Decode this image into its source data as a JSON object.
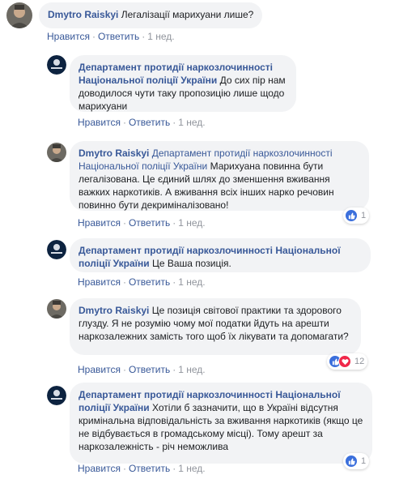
{
  "actions": {
    "like": "Нравится",
    "reply": "Ответить",
    "sep": "·"
  },
  "comments": [
    {
      "author": "Dmytro Raiskyi",
      "text": "Легалізації марихуани лише?",
      "time": "1 нед."
    },
    {
      "author": "Департамент протидії наркозлочинності Національної поліції України",
      "text": "До сих пір нам доводилося чути таку пропозицію лише щодо марихуани",
      "time": "1 нед."
    },
    {
      "author": "Dmytro Raiskyi",
      "mention": "Департамент протидії наркозлочинності Національної поліції України",
      "text": "Марихуана повинна бути легалізована. Це єдиний шлях до зменшення вживання важких наркотиків. А вживання всіх інших нарко речовин повинно бути декриміналізовано!",
      "time": "1 нед.",
      "reactions": {
        "count": "1",
        "types": [
          "like"
        ]
      }
    },
    {
      "author": "Департамент протидії наркозлочинності Національної поліції України",
      "text": "Це Ваша позиція.",
      "time": "1 нед."
    },
    {
      "author": "Dmytro Raiskyi",
      "text": "Це позиція світової практики та здорового глузду. Я не розумію чому мої податки йдуть на арешти наркозалежних замість того щоб їх лікувати та допомагати?",
      "time": "1 нед.",
      "reactions": {
        "count": "12",
        "types": [
          "like",
          "love"
        ]
      }
    },
    {
      "author": "Департамент протидії наркозлочинності Національної поліції України",
      "text": "Хотіли б зазначити, що в Україні відсутня кримінальна відповідальність за вживання наркотиків (якщо це не відбувається в громадському місці). Тому арешт за наркозалежність - річ неможлива",
      "time": "1 нед.",
      "reactions": {
        "count": "1",
        "types": [
          "like"
        ]
      }
    }
  ]
}
